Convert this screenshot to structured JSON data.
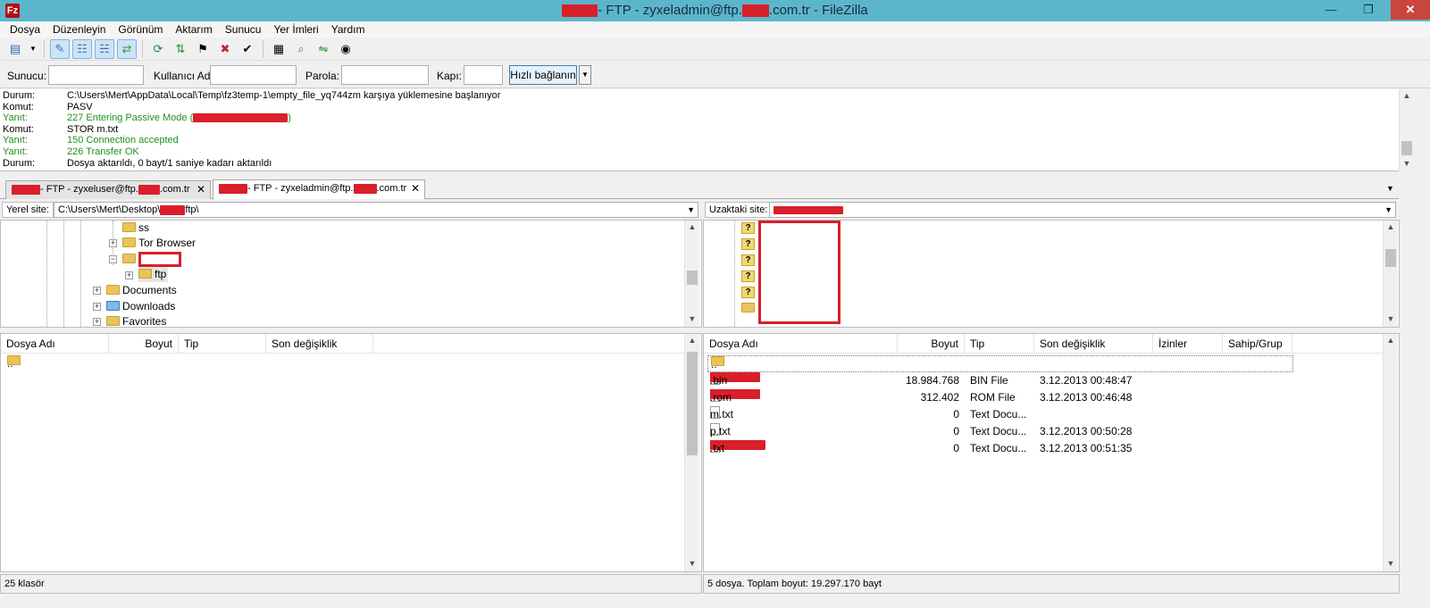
{
  "titlebar": {
    "app_icon": "Fz",
    "title_text": "- FTP - zyxeladmin@ftp.",
    "title_suffix": ".com.tr - FileZilla",
    "minimize": "—",
    "maximize": "❐",
    "close": "✕"
  },
  "menu": [
    "Dosya",
    "Düzenleyin",
    "Görünüm",
    "Aktarım",
    "Sunucu",
    "Yer İmleri",
    "Yardım"
  ],
  "toolbar_icons": [
    "site-manager-icon",
    "dropdown-arrow-icon",
    "message-log-icon",
    "local-tree-icon",
    "remote-tree-icon",
    "transfer-queue-icon",
    "refresh-icon",
    "process-queue-icon",
    "cancel-icon",
    "disconnect-icon",
    "reconnect-icon",
    "filter-icon",
    "compare-icon",
    "sync-browse-icon",
    "search-icon"
  ],
  "quickconnect": {
    "host_label": "Sunucu:",
    "user_label": "Kullanıcı Adı:",
    "pass_label": "Parola:",
    "port_label": "Kapı:",
    "connect_label": "Hızlı bağlanın",
    "host_value": "",
    "user_value": "",
    "pass_value": "",
    "port_value": ""
  },
  "log": [
    {
      "k": "Durum:",
      "v": "C:\\Users\\Mert\\AppData\\Local\\Temp\\fz3temp-1\\empty_file_yq744zm karşıya yüklemesine başlanıyor",
      "type": "status"
    },
    {
      "k": "Komut:",
      "v": "PASV",
      "type": "cmd"
    },
    {
      "k": "Yanıt:",
      "v": "227 Entering Passive Mode (",
      "type": "resp",
      "redacted": true
    },
    {
      "k": "Komut:",
      "v": "STOR m.txt",
      "type": "cmd"
    },
    {
      "k": "Yanıt:",
      "v": "150 Connection accepted",
      "type": "resp"
    },
    {
      "k": "Yanıt:",
      "v": "226 Transfer OK",
      "type": "resp"
    },
    {
      "k": "Durum:",
      "v": "Dosya aktarıldı, 0 bayt/1 saniye kadarı aktarıldı",
      "type": "status"
    }
  ],
  "tabs": [
    {
      "label": "- FTP - zyxeluser@ftp.",
      "suffix": ".com.tr",
      "close": "✕"
    },
    {
      "label": "- FTP - zyxeladmin@ftp.",
      "suffix": ".com.tr",
      "close": "✕"
    }
  ],
  "local": {
    "site_label": "Yerel site:",
    "path_prefix": "C:\\Users\\Mert\\Desktop\\",
    "path_suffix": "ftp\\",
    "tree": [
      "ss",
      "Tor Browser",
      "ftp",
      "Documents",
      "Downloads",
      "Favorites"
    ],
    "columns": [
      "Dosya Adı",
      "Boyut",
      "Tip",
      "Son değişiklik"
    ],
    "rows": [
      ".."
    ],
    "status": "25 klasör"
  },
  "remote": {
    "site_label": "Uzaktaki site:",
    "tree_icon_glyph": "?",
    "columns": [
      "Dosya Adı",
      "Boyut",
      "Tip",
      "Son değişiklik",
      "İzinler",
      "Sahip/Grup"
    ],
    "rows": [
      {
        "name": "..",
        "size": "",
        "type": "",
        "modified": "",
        "redacted": false,
        "folder": true
      },
      {
        "name": ".bin",
        "size": "18.984.768",
        "type": "BIN File",
        "modified": "3.12.2013 00:48:47",
        "redacted": true
      },
      {
        "name": ".rom",
        "size": "312.402",
        "type": "ROM File",
        "modified": "3.12.2013 00:46:48",
        "redacted": true
      },
      {
        "name": "m.txt",
        "size": "0",
        "type": "Text Docu...",
        "modified": "",
        "redacted": false
      },
      {
        "name": "p.txt",
        "size": "0",
        "type": "Text Docu...",
        "modified": "3.12.2013 00:50:28",
        "redacted": false
      },
      {
        "name": ".txt",
        "size": "0",
        "type": "Text Docu...",
        "modified": "3.12.2013 00:51:35",
        "redacted": true
      }
    ],
    "status": "5 dosya. Toplam boyut: 19.297.170 bayt"
  },
  "colors": {
    "titlebar": "#5bb6cc",
    "response_text": "#1e8f1e",
    "redaction": "#d81f2a",
    "close_button": "#c9463d"
  }
}
